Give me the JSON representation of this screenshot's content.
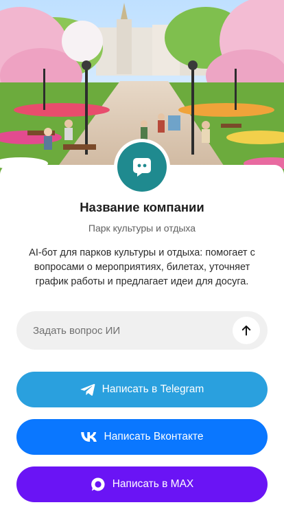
{
  "profile": {
    "company_name": "Название компании",
    "category": "Парк культуры и отдыха",
    "description": "AI-бот для парков культуры и отдыха: помогает с вопросами о мероприятиях, билетах, уточняет график работы и предлагает идеи для досуга.",
    "avatar_icon": "chat-bot-icon",
    "avatar_color": "#1f8a8f"
  },
  "ask": {
    "placeholder": "Задать вопрос ИИ",
    "send_icon": "arrow-up-icon"
  },
  "buttons": {
    "telegram": {
      "label": "Написать в Telegram",
      "icon": "telegram-icon",
      "color": "#2aa0de"
    },
    "vk": {
      "label": "Написать Вконтакте",
      "icon": "vk-icon",
      "color": "#0a77ff"
    },
    "max": {
      "label": "Написать в MAX",
      "icon": "max-icon",
      "color": "#6a14f5"
    }
  }
}
